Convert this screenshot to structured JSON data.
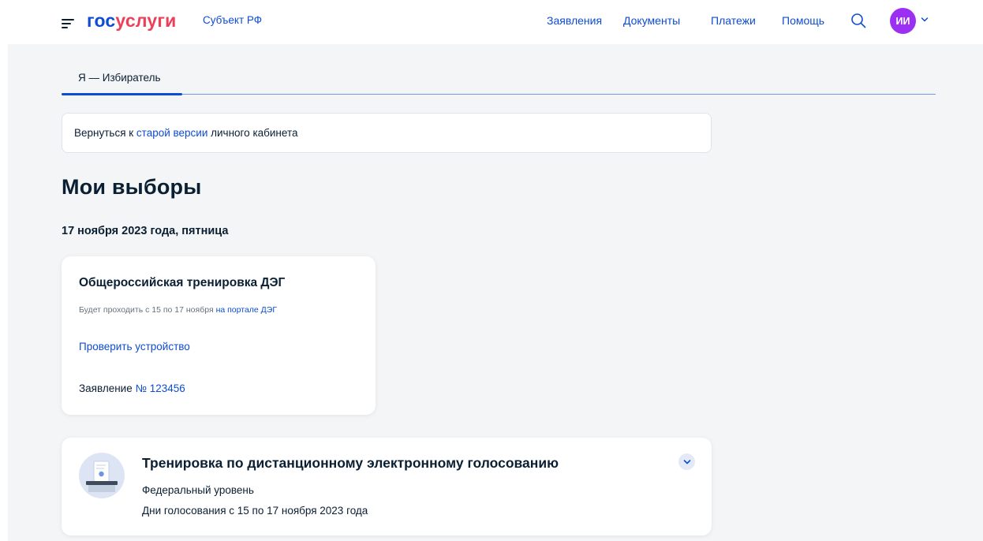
{
  "header": {
    "logo_part1": "гос",
    "logo_part2": "услуги",
    "region": "Субъект РФ",
    "nav": [
      "Заявления",
      "Документы",
      "Платежи",
      "Помощь"
    ],
    "avatar_initials": "ИИ",
    "icons": {
      "menu": "hamburger-icon",
      "search": "search-icon",
      "chevron": "chevron-down-icon"
    },
    "colors": {
      "brand_blue": "#0d4cd3",
      "brand_red": "#ee3f58",
      "avatar": "#9b30f2"
    }
  },
  "tabs": [
    {
      "label": "Я — Избиратель",
      "active": true
    }
  ],
  "notice": {
    "prefix": "Вернуться к ",
    "link": "старой версии",
    "suffix": " личного кабинета"
  },
  "page": {
    "title": "Мои выборы",
    "date": "17 ноября 2023 года, пятница"
  },
  "event_card": {
    "title": "Общероссийская тренировка ДЭГ",
    "subtitle_prefix": "Будет проходить с 15 по 17 ноября ",
    "subtitle_link": "на портале ДЭГ",
    "check_device": "Проверить устройство",
    "application_label": "Заявление ",
    "application_number": "№ 123456"
  },
  "election_card": {
    "title": "Тренировка по дистанционному электронному голосованию",
    "level": "Федеральный уровень",
    "days": "Дни голосования с 15 по 17 ноября 2023 года",
    "icons": {
      "ballot": "ballot-box-icon",
      "expand": "chevron-down-icon"
    }
  }
}
